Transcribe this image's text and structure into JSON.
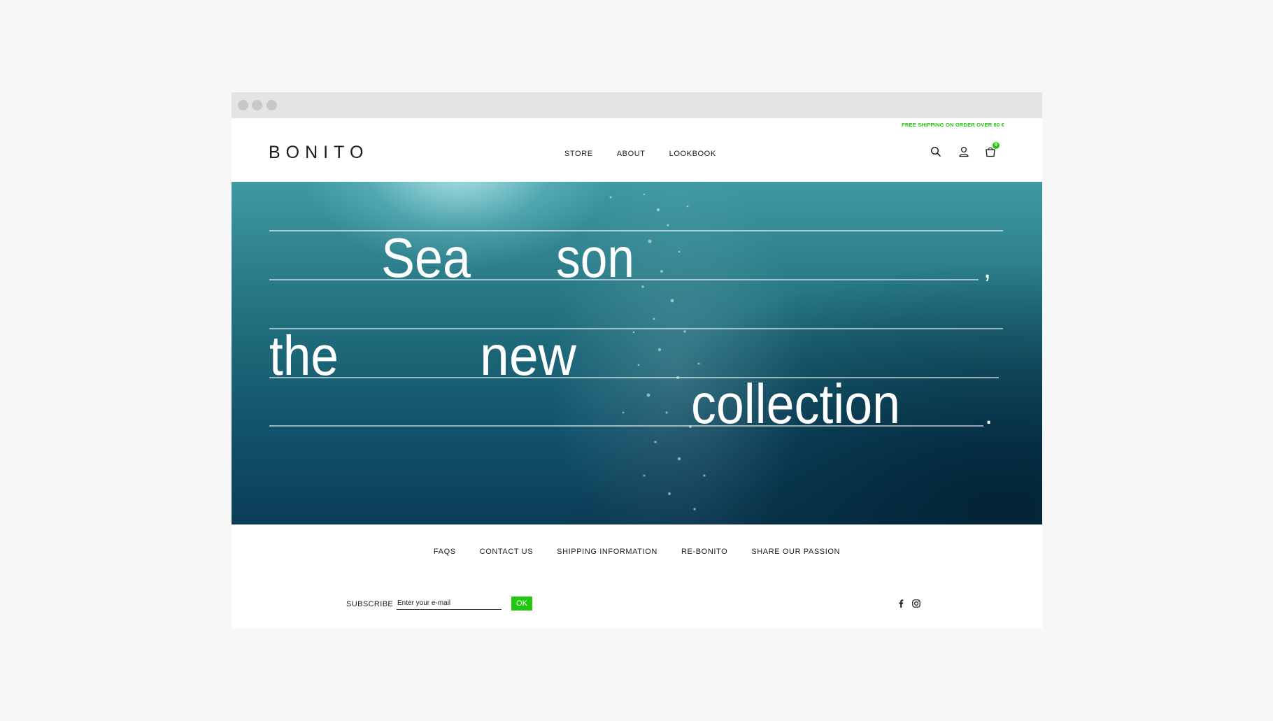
{
  "colors": {
    "accent": "#22c70f",
    "text": "#1a1a1a",
    "page_bg": "#f7f7f7",
    "titlebar": "#e4e4e4"
  },
  "browser": {
    "controls": [
      "window-dot",
      "window-dot",
      "window-dot"
    ]
  },
  "header": {
    "promo": "FREE SHIPPING ON ORDER OVER 80 €",
    "logo": "BONITO",
    "nav": [
      {
        "label": "STORE"
      },
      {
        "label": "ABOUT"
      },
      {
        "label": "LOOKBOOK"
      }
    ],
    "icons": [
      "search-icon",
      "account-icon",
      "cart-icon"
    ],
    "cart_count": "0"
  },
  "hero": {
    "lines": [
      {
        "word1": "Sea",
        "word2": "son",
        "end": ","
      },
      {
        "word1": "the",
        "word2": "new"
      },
      {
        "word1": "collection",
        "end": "."
      }
    ]
  },
  "footer": {
    "nav": [
      {
        "label": "FAQS"
      },
      {
        "label": "CONTACT US"
      },
      {
        "label": "SHIPPING INFORMATION"
      },
      {
        "label": "RE-BONITO"
      },
      {
        "label": "SHARE OUR PASSION"
      }
    ],
    "subscribe": {
      "label": "SUBSCRIBE",
      "placeholder": "Enter your e-mail",
      "button": "OK"
    },
    "social": [
      "facebook-icon",
      "instagram-icon"
    ]
  }
}
